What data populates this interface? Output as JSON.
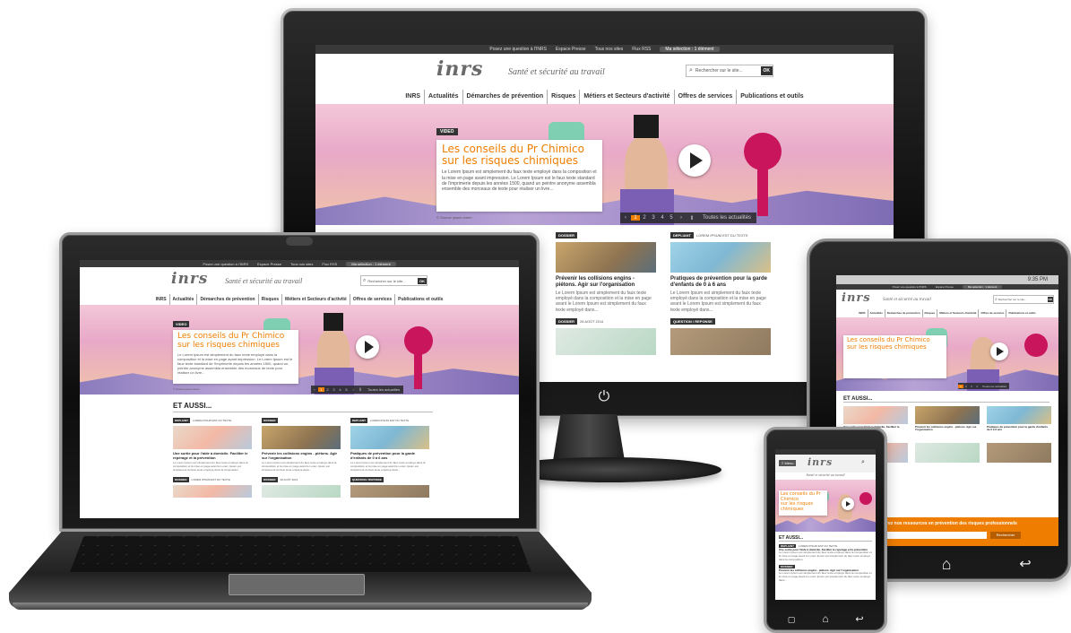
{
  "site": {
    "topbar": {
      "question": "Posez une question à l'INRS",
      "presse": "Espace Presse",
      "sites": "Tous nos sites",
      "rss": "Flux RSS",
      "selection": "Ma sélection : 1 élément"
    },
    "logo": "inrs",
    "tagline": "Santé et sécurité au travail",
    "search_placeholder": "Rechercher sur le site...",
    "search_ok": "OK",
    "nav": [
      "INRS",
      "Actualités",
      "Démarches de prévention",
      "Risques",
      "Métiers et Secteurs d'activité",
      "Offres de services",
      "Publications et outils"
    ],
    "hero": {
      "tag": "VIDEO",
      "title_line1": "Les conseils du Pr Chimico",
      "title_line2": "sur les risques chimiques",
      "desc": "Le Lorem Ipsum est simplement du faux texte employé dans la composition et la mise en page avant impression. Le Lorem Ipsum est le faux texte standard de l'imprimerie depuis les années 1500, quand un peintre anonyme assembla ensemble des morceaux de texte pour réaliser un livre...",
      "credit": "© Source ipsum lorem",
      "pages": [
        "1",
        "2",
        "3",
        "4",
        "5"
      ],
      "all_news": "Toutes les actualités"
    },
    "also": {
      "title": "ET AUSSI...",
      "cards": [
        {
          "tag": "DEPLIANT",
          "sub": "LOREM IPSUM EST DU TEXTE",
          "title": "Une sortie pour l'aide à domicile. Faciliter le repérage et la prévention",
          "text": "Le Lorem Ipsum est simplement du faux texte employé dans la composition et la mise en page avant le Lorem Ipsum est simplement du faux texte employé dans la composition."
        },
        {
          "tag": "DOSSIER",
          "sub": "",
          "title": "Prévenir les collisions engins - piétons. Agir sur l'organisation",
          "text": "Le Lorem Ipsum est simplement du faux texte employé dans la composition et la mise en page avant le Lorem Ipsum est simplement du faux texte employé dans..."
        },
        {
          "tag": "DEPLIANT",
          "sub": "LOREM IPSUM EST DU TEXTE",
          "title": "Pratiques de prévention pour la garde d'enfants de 0 à 6 ans",
          "text": "Le Lorem Ipsum est simplement du faux texte employé dans la composition et la mise en page avant le Lorem Ipsum est simplement du faux texte employé dans..."
        }
      ],
      "row2": [
        {
          "tag": "DOSSIER",
          "sub": "LOREM IPSUM EST DU TEXTE"
        },
        {
          "tag": "DOSSIER",
          "sub": "28 AOÛT 2014"
        },
        {
          "tag": "QUESTION / REPONSE",
          "sub": ""
        }
      ]
    },
    "phone_menu": "Menu",
    "tablet_time": "9:35 PM",
    "tablet_footer": "Découvrez nos ressources en prévention des risques professionnels",
    "tablet_footer_btn": "Rechercher"
  },
  "colors": {
    "accent": "#ef7d00",
    "dark": "#333333",
    "hero_pink": "#e8a9c8",
    "magenta": "#c8155c"
  },
  "icons": [
    "power-icon",
    "search-icon",
    "play-icon",
    "home-icon",
    "back-icon",
    "menu-icon",
    "windows-icon"
  ]
}
